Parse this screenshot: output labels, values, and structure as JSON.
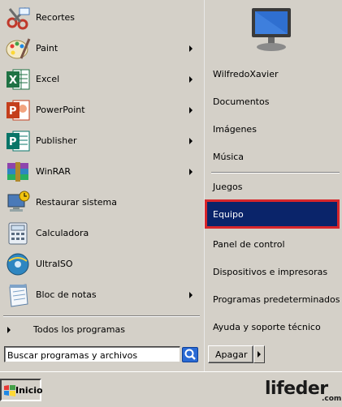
{
  "start_menu": {
    "programs": [
      {
        "label": "Recortes",
        "icon": "scissors-icon",
        "has_submenu": false
      },
      {
        "label": "Paint",
        "icon": "paint-palette-icon",
        "has_submenu": true
      },
      {
        "label": "Excel",
        "icon": "excel-icon",
        "has_submenu": true
      },
      {
        "label": "PowerPoint",
        "icon": "powerpoint-icon",
        "has_submenu": true
      },
      {
        "label": "Publisher",
        "icon": "publisher-icon",
        "has_submenu": true
      },
      {
        "label": "WinRAR",
        "icon": "winrar-icon",
        "has_submenu": true
      },
      {
        "label": "Restaurar sistema",
        "icon": "system-restore-icon",
        "has_submenu": false
      },
      {
        "label": "Calculadora",
        "icon": "calculator-icon",
        "has_submenu": false
      },
      {
        "label": "UltraISO",
        "icon": "ultraiso-icon",
        "has_submenu": false
      },
      {
        "label": "Bloc de notas",
        "icon": "notepad-icon",
        "has_submenu": true
      }
    ],
    "all_programs_label": "Todos los programas",
    "search": {
      "value": "Buscar programas y archivos",
      "icon": "search-icon"
    },
    "right_items": [
      {
        "label": "WilfredoXavier",
        "selected": false
      },
      {
        "label": "Documentos",
        "selected": false
      },
      {
        "label": "Imágenes",
        "selected": false
      },
      {
        "label": "Música",
        "selected": false
      },
      {
        "label": "Juegos",
        "selected": false
      },
      {
        "label": "Equipo",
        "selected": true
      },
      {
        "label": "Panel de control",
        "selected": false
      },
      {
        "label": "Dispositivos e impresoras",
        "selected": false
      },
      {
        "label": "Programas predeterminados",
        "selected": false
      },
      {
        "label": "Ayuda y soporte técnico",
        "selected": false
      }
    ],
    "shutdown_label": "Apagar"
  },
  "taskbar": {
    "start_label": "Inicio"
  },
  "watermark": {
    "brand": "lifeder",
    "suffix": ".com"
  },
  "colors": {
    "menu_bg": "#d4d0c8",
    "selection": "#0a246a",
    "highlight_border": "#d8262b"
  }
}
